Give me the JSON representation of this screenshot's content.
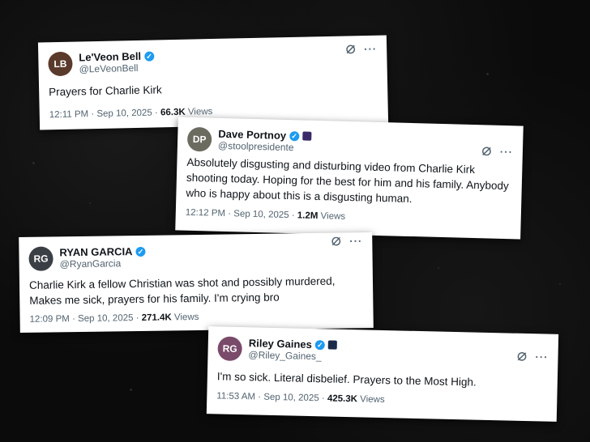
{
  "colors": {
    "background": "#0b0b0b",
    "card": "#ffffff",
    "text": "#0f1419",
    "muted": "#536471",
    "verified": "#1d9bf0"
  },
  "icons": {
    "verified": "verified-badge-icon",
    "grok": "grok-icon",
    "more": "more-options-icon"
  },
  "tweets": [
    {
      "name": "Le'Veon Bell",
      "handle": "@LeVeonBell",
      "text": "Prayers for Charlie Kirk",
      "time": "12:11 PM · Sep 10, 2025 ·",
      "views": "66.3K",
      "views_label": "Views",
      "avatar_color": "#5a3a2a"
    },
    {
      "name": "Dave Portnoy",
      "handle": "@stoolpresidente",
      "text": "Absolutely disgusting and disturbing video from Charlie Kirk shooting today.  Hoping for the best for him and his family.   Anybody who is happy about this is a disgusting human.",
      "time": "12:12 PM · Sep 10, 2025 ·",
      "views": "1.2M",
      "views_label": "Views",
      "avatar_color": "#6b6b60"
    },
    {
      "name": "RYAN GARCIA",
      "handle": "@RyanGarcia",
      "text": "Charlie Kirk a fellow Christian was shot and possibly murdered, Makes me sick, prayers for his family. I'm crying bro",
      "time": "12:09 PM · Sep 10, 2025 ·",
      "views": "271.4K",
      "views_label": "Views",
      "avatar_color": "#3a3f45"
    },
    {
      "name": "Riley Gaines",
      "handle": "@Riley_Gaines_",
      "text": "I'm so sick. Literal disbelief. Prayers to the Most High.",
      "time": "11:53 AM · Sep 10, 2025 ·",
      "views": "425.3K",
      "views_label": "Views",
      "avatar_color": "#7a4a6a"
    }
  ]
}
